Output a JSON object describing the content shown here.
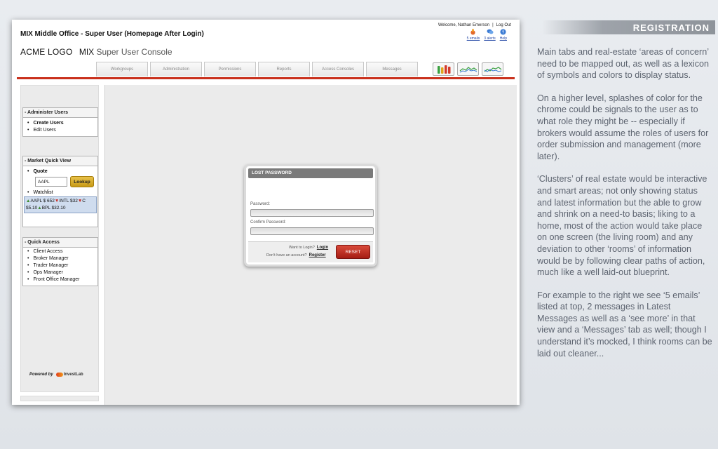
{
  "window": {
    "title": "MIX Middle Office - Super User (Homepage After Login)",
    "welcome": "Welcome, Nathan Emerson",
    "logout": "Log Out",
    "user_icons": [
      {
        "label": "5 emails",
        "icon": "mail-icon",
        "color": "#d9531e"
      },
      {
        "label": "3 alerts",
        "icon": "chat-icon",
        "color": "#3b7bd4"
      },
      {
        "label": "Help",
        "icon": "help-icon",
        "color": "#3b7bd4"
      }
    ],
    "logo": "ACME LOGO",
    "mix": "MIX",
    "console": "Super User Console"
  },
  "tabs": [
    "Workgroups",
    "Administration",
    "Permissions",
    "Reports",
    "Access Consoles",
    "Messages"
  ],
  "status_icons": [
    "bars-icon",
    "trend-chart-icon",
    "trend-chart-icon"
  ],
  "administer": {
    "title": "- Administer Users",
    "items": [
      "Create Users",
      "Edit Users"
    ]
  },
  "market": {
    "title": "- Market Quick View",
    "quote_label": "Quote",
    "quote_value": "AAPL",
    "lookup": "Lookup",
    "watchlist": "Watchlist",
    "ticker_line1": "AAPL  $ 652",
    "ticker_line1b": "INTL  $32",
    "ticker_line1c": "C",
    "ticker_line2a": "$5.10",
    "ticker_line2b": "BPL  $32.10"
  },
  "quick_access": {
    "title": "- Quick Access",
    "items": [
      "Client Access",
      "Broker Manager",
      "Trader Manager",
      "Ops Manager",
      "Front Office Manager"
    ]
  },
  "powered": {
    "label": "Powered by",
    "brand": "InvestLab"
  },
  "dialog": {
    "title": "LOST PASSWORD",
    "password_label": "Password:",
    "confirm_label": "Confirm Password:",
    "login_prompt": "Want to Login?",
    "login_link": "Login",
    "register_prompt": "Don't have an account?",
    "register_link": "Register",
    "reset": "RESET"
  },
  "notes": {
    "banner": "REGISTRATION",
    "paragraphs": [
      "Main tabs and real-estate ‘areas of concern’ need to be mapped out, as well as a lexicon of symbols and colors to display status.",
      "On a higher level, splashes of color for the chrome could be signals to the user as to what role they might be -- especially if brokers would assume the roles of users for order submission and management (more later).",
      "‘Clusters’ of real estate would be interactive and smart areas; not only showing status and latest information but the able to grow and shrink on a need-to basis; liking to a home, most of the action would take place on one screen (the living room) and any deviation to other ‘rooms’ of information would be by following clear paths of action, much like a well laid-out blueprint.",
      "For example to the right we see ‘5 emails’ listed at top, 2 messages in Latest Messages as well as a ‘see more’ in that view and a ‘Messages’ tab as well; though I understand it’s mocked, I think rooms can be laid out cleaner..."
    ]
  }
}
